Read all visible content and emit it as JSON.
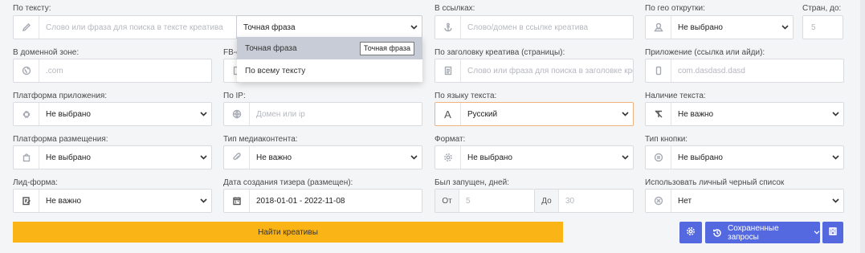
{
  "labels": {
    "po_tekstu": "По тексту:",
    "v_ssylkah": "В ссылках:",
    "po_geo": "По гео открутки:",
    "stran_do": "Стран, до:",
    "v_domennoy": "В доменной зоне:",
    "fb": "FB-с",
    "po_zagolovku": "По заголовку креатива (страницы):",
    "prilozhenie": "Приложение (ссылка или айди):",
    "platforma_prilozheniya": "Платформа приложения:",
    "po_ip": "По IP:",
    "po_yazyku": "По языку текста:",
    "nalichie_teksta": "Наличие текста:",
    "platforma_razmescheniya": "Платформа размещения:",
    "tip_media": "Тип медиаконтента:",
    "format": "Формат:",
    "tip_knopki": "Тип кнопки:",
    "lid_forma": "Лид-форма:",
    "data_sozdaniya": "Дата создания тизера (размещен):",
    "byl_zapuschen": "Был запущен, дней:",
    "chernyy_spisok": "Использовать личный черный список"
  },
  "fields": {
    "text_search": {
      "placeholder": "Слово или фраза для поиска в тексте креатива"
    },
    "phrase_mode": {
      "value": "Точная фраза"
    },
    "link_search": {
      "placeholder": "Слово/домен в ссылке креатива"
    },
    "geo": {
      "value": "Не выбрано"
    },
    "countries_max": {
      "placeholder": "5"
    },
    "domain_zone": {
      "placeholder": ".com"
    },
    "title_search": {
      "placeholder": "Слово или фраза для поиска в заголовке кре"
    },
    "app": {
      "placeholder": "com.dasdasd.dasd"
    },
    "app_platform": {
      "value": "Не выбрано"
    },
    "ip": {
      "placeholder": "Домен или ip"
    },
    "language": {
      "value": "Русский",
      "icon_text": "A"
    },
    "has_text": {
      "value": "Не важно"
    },
    "placement_platform": {
      "value": "Не выбрано"
    },
    "media_type": {
      "value": "Не важно"
    },
    "format": {
      "value": "Не выбрано"
    },
    "button_type": {
      "value": "Не выбрано"
    },
    "lead_form": {
      "value": "Не важно"
    },
    "created_date": {
      "value": "2018-01-01 - 2022-11-08"
    },
    "days_from": {
      "prefix": "От",
      "placeholder": "5"
    },
    "days_to": {
      "prefix": "До",
      "placeholder": "30"
    },
    "blacklist": {
      "value": "Нет"
    }
  },
  "dropdown": {
    "items": [
      "Точная фраза",
      "По всему тексту"
    ],
    "tooltip": "Точная фраза"
  },
  "buttons": {
    "find": "Найти креативы",
    "saved_queries": "Сохраненные запросы"
  },
  "colors": {
    "accent": "#fbb416",
    "primary": "#5468e0",
    "focus_border": "#f0b37e"
  }
}
